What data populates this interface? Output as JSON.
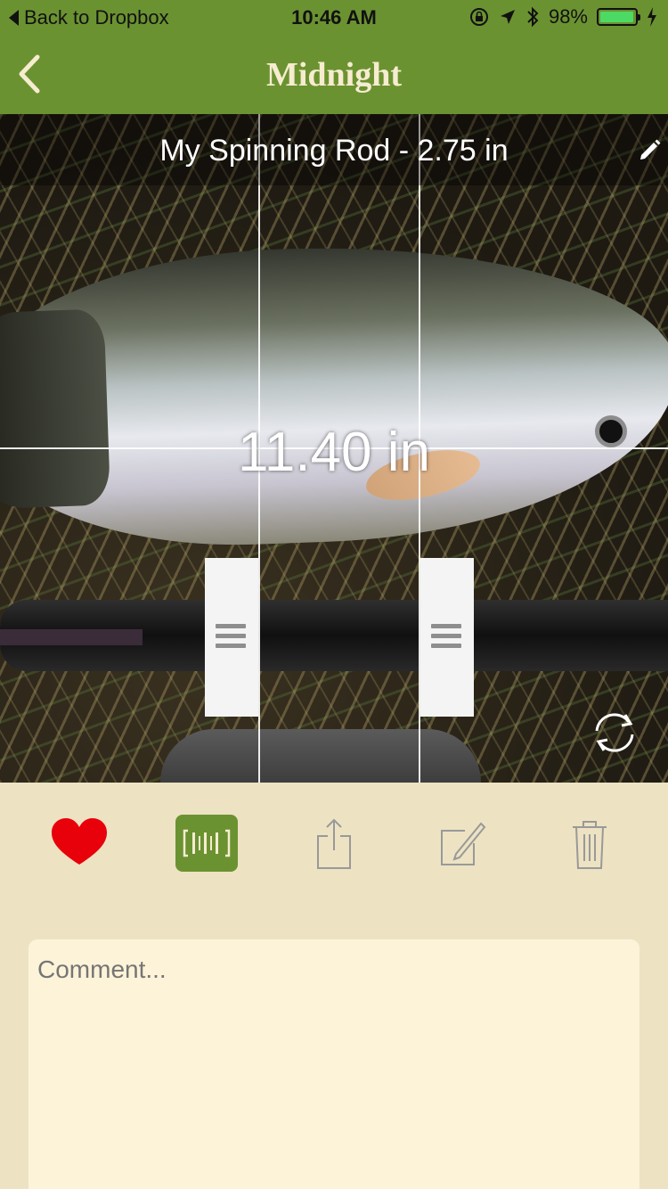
{
  "status_bar": {
    "back_label": "Back to Dropbox",
    "time": "10:46 AM",
    "battery_percent": "98%",
    "battery_level": 0.98
  },
  "nav": {
    "title": "Midnight",
    "back_icon": "chevron-left-icon"
  },
  "photo": {
    "reference_label": "My Spinning Rod - 2.75 in",
    "measurement": "11.40 in"
  },
  "toolbar": {
    "items": [
      "heart-icon",
      "barcode-scan-icon",
      "share-icon",
      "edit-icon",
      "trash-icon"
    ]
  },
  "comment": {
    "placeholder": "Comment..."
  },
  "colors": {
    "accent": "#6b9231",
    "background": "#ede2c2",
    "comment_bg": "#fdf3d8",
    "heart": "#e8000b",
    "nav_title": "#f6ecd0"
  }
}
